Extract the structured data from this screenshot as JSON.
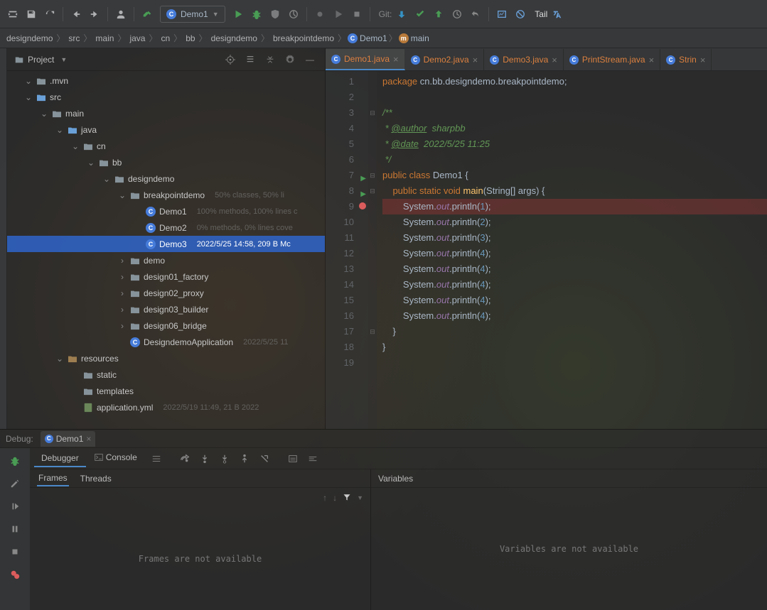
{
  "toolbar": {
    "run_config": "Demo1",
    "git_label": "Git:",
    "tail_label": "Tail"
  },
  "breadcrumb": {
    "items": [
      "designdemo",
      "src",
      "main",
      "java",
      "cn",
      "bb",
      "designdemo",
      "breakpointdemo"
    ],
    "class": "Demo1",
    "method": "main"
  },
  "project": {
    "title": "Project",
    "tree": [
      {
        "depth": 0,
        "open": true,
        "type": "folder",
        "name": ".mvn"
      },
      {
        "depth": 0,
        "open": true,
        "type": "src",
        "name": "src"
      },
      {
        "depth": 1,
        "open": true,
        "type": "folder",
        "name": "main"
      },
      {
        "depth": 2,
        "open": true,
        "type": "src",
        "name": "java"
      },
      {
        "depth": 3,
        "open": true,
        "type": "folder",
        "name": "cn"
      },
      {
        "depth": 4,
        "open": true,
        "type": "folder",
        "name": "bb"
      },
      {
        "depth": 5,
        "open": true,
        "type": "folder",
        "name": "designdemo"
      },
      {
        "depth": 6,
        "open": true,
        "type": "folder",
        "name": "breakpointdemo",
        "meta": "50% classes, 50% li"
      },
      {
        "depth": 7,
        "type": "class",
        "name": "Demo1",
        "meta": "100% methods, 100% lines c"
      },
      {
        "depth": 7,
        "type": "class",
        "name": "Demo2",
        "meta": "0% methods, 0% lines cove"
      },
      {
        "depth": 7,
        "type": "class",
        "name": "Demo3",
        "meta": "2022/5/25 14:58, 209 B Mc",
        "selected": true
      },
      {
        "depth": 6,
        "open": false,
        "type": "folder",
        "name": "demo"
      },
      {
        "depth": 6,
        "open": false,
        "type": "folder",
        "name": "design01_factory"
      },
      {
        "depth": 6,
        "open": false,
        "type": "folder",
        "name": "design02_proxy"
      },
      {
        "depth": 6,
        "open": false,
        "type": "folder",
        "name": "design03_builder"
      },
      {
        "depth": 6,
        "open": false,
        "type": "folder",
        "name": "design06_bridge"
      },
      {
        "depth": 6,
        "type": "class",
        "name": "DesigndemoApplication",
        "meta": "2022/5/25 11",
        "spring": true
      },
      {
        "depth": 2,
        "open": true,
        "type": "res",
        "name": "resources"
      },
      {
        "depth": 3,
        "type": "folder",
        "name": "static"
      },
      {
        "depth": 3,
        "type": "folder",
        "name": "templates"
      },
      {
        "depth": 3,
        "type": "yml",
        "name": "application.yml",
        "meta": "2022/5/19 11:49, 21 B 2022"
      }
    ]
  },
  "editor": {
    "tabs": [
      {
        "name": "Demo1.java",
        "active": true
      },
      {
        "name": "Demo2.java"
      },
      {
        "name": "Demo3.java"
      },
      {
        "name": "PrintStream.java"
      },
      {
        "name": "Strin"
      }
    ],
    "code": {
      "package_kw": "package",
      "package_val": "cn.bb.designdemo.breakpointdemo",
      "doc_open": "/**",
      "doc_author_tag": "@author",
      "doc_author": "sharpbb",
      "doc_date_tag": "@date",
      "doc_date": "2022/5/25 11:25",
      "doc_close": "*/",
      "public": "public",
      "class_kw": "class",
      "class_name": "Demo1",
      "static": "static",
      "void": "void",
      "main": "main",
      "args": "(String[] args) {",
      "sys": "System",
      "out": "out",
      "println": "println",
      "vals": [
        "1",
        "2",
        "3",
        "4",
        "4",
        "4",
        "4",
        "4"
      ]
    },
    "gutter": {
      "lines": 19,
      "run_lines": [
        7,
        8
      ],
      "bp_lines": [
        9
      ]
    }
  },
  "debug": {
    "label": "Debug:",
    "config": "Demo1",
    "tabs": {
      "debugger": "Debugger",
      "console": "Console"
    },
    "frames": {
      "tab1": "Frames",
      "tab2": "Threads",
      "empty": "Frames are not available"
    },
    "vars": {
      "title": "Variables",
      "empty": "Variables are not available"
    }
  }
}
